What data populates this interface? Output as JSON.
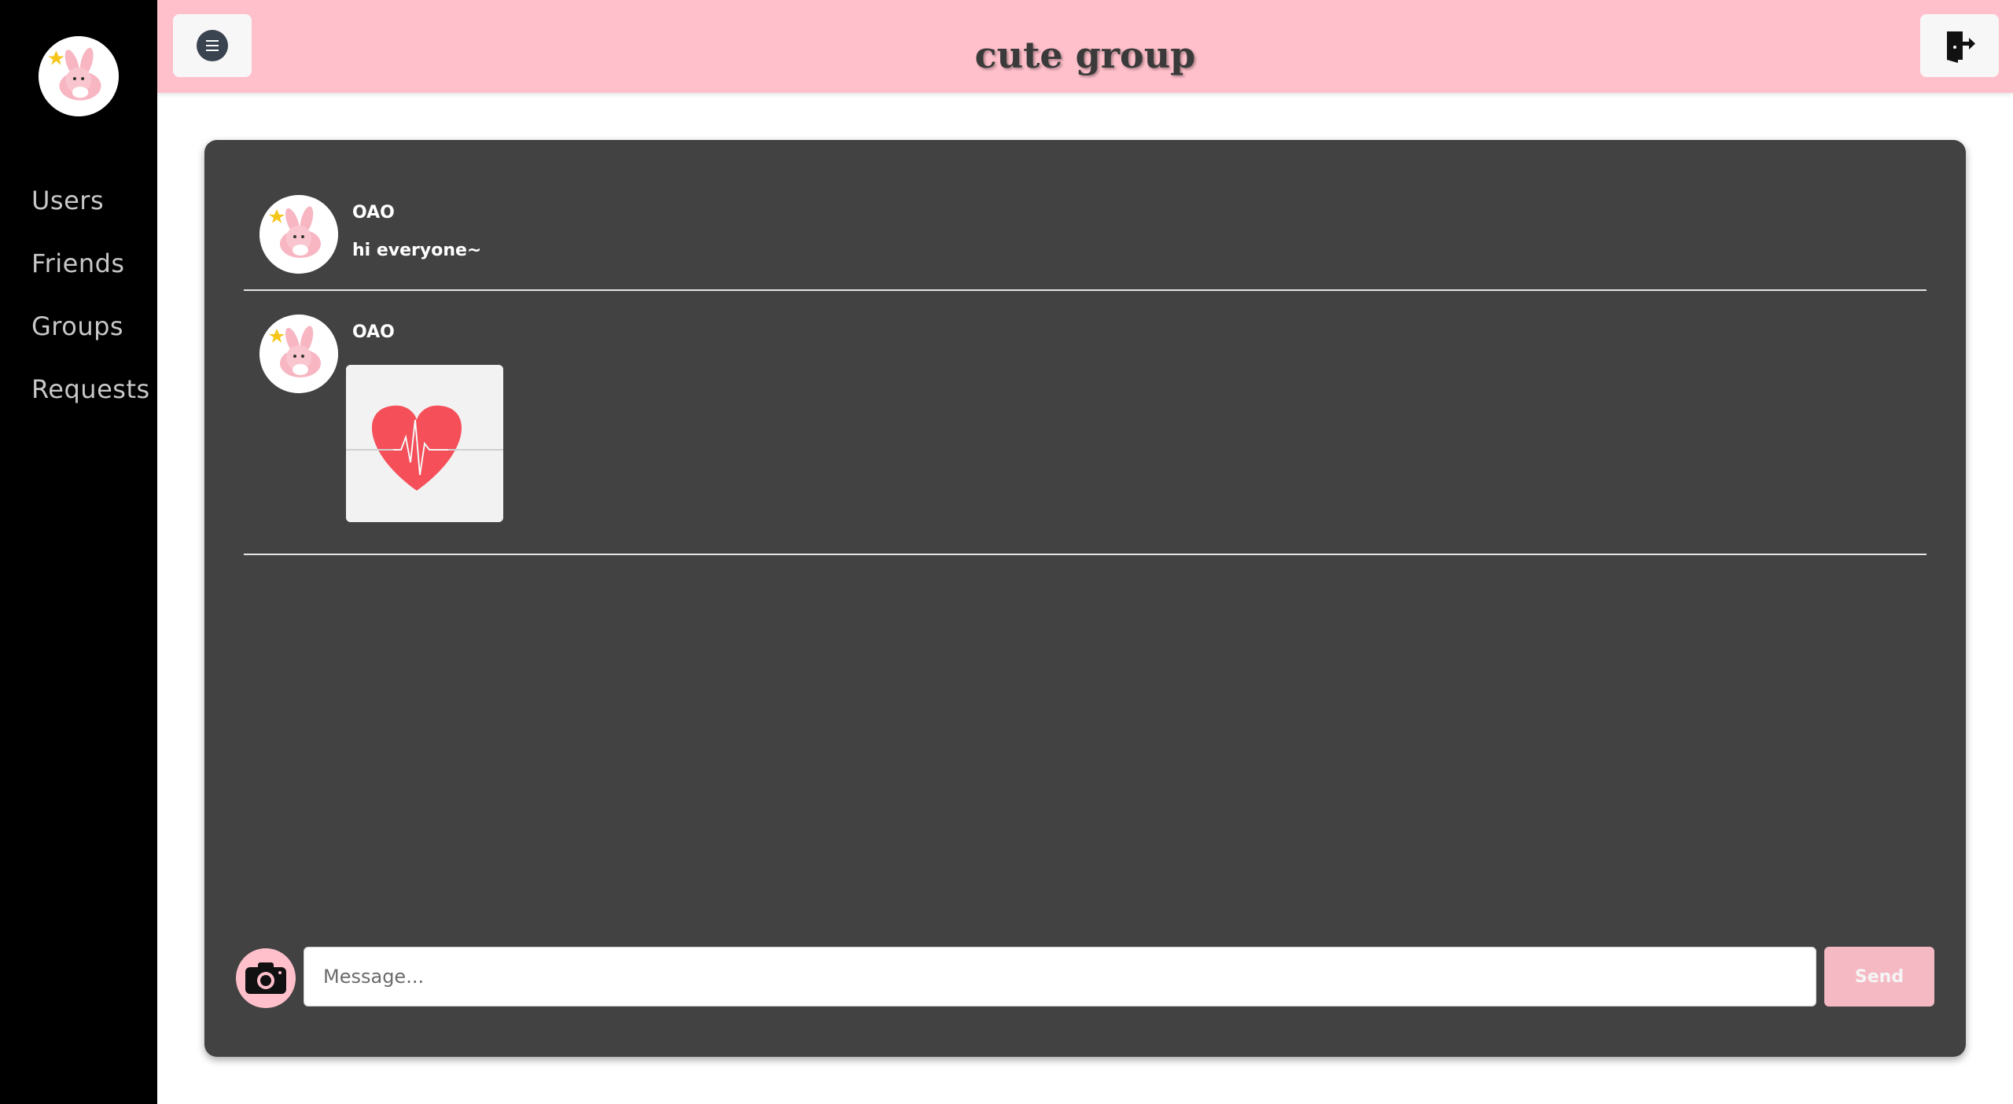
{
  "header": {
    "title": "cute group",
    "menu_icon": "menu-circle-icon",
    "logout_icon": "door-exit-icon"
  },
  "sidebar": {
    "items": [
      {
        "label": "Users"
      },
      {
        "label": "Friends"
      },
      {
        "label": "Groups"
      },
      {
        "label": "Requests"
      }
    ]
  },
  "messages": [
    {
      "user": "OAO",
      "text": "hi everyone~"
    },
    {
      "user": "OAO",
      "image": "heart-pulse-image"
    }
  ],
  "composer": {
    "placeholder": "Message...",
    "send_label": "Send",
    "camera_icon": "camera-icon"
  },
  "colors": {
    "accent_pink": "#ffc0cb",
    "sidebar_bg": "#000000",
    "chat_bg": "#424242"
  }
}
